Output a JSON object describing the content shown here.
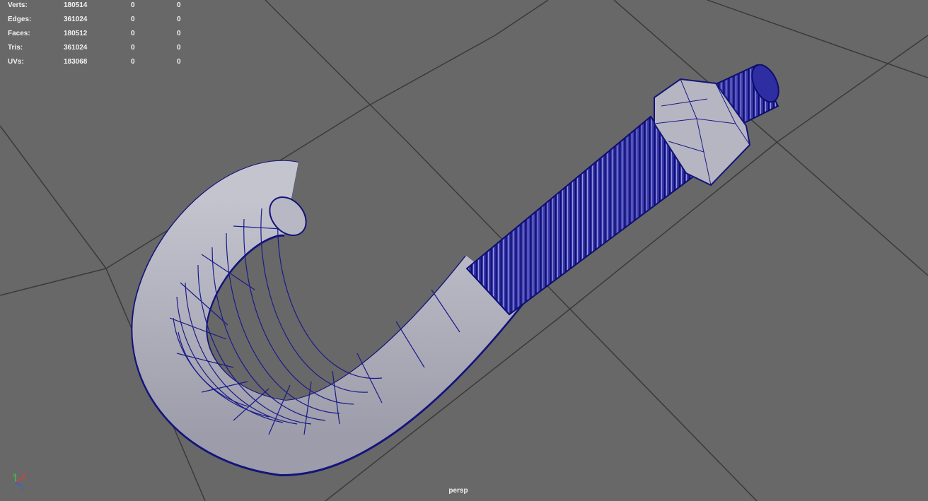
{
  "stats": [
    {
      "label": "Verts:",
      "total": "180514",
      "selected": "0",
      "component": "0"
    },
    {
      "label": "Edges:",
      "total": "361024",
      "selected": "0",
      "component": "0"
    },
    {
      "label": "Faces:",
      "total": "180512",
      "selected": "0",
      "component": "0"
    },
    {
      "label": "Tris:",
      "total": "361024",
      "selected": "0",
      "component": "0"
    },
    {
      "label": "UVs:",
      "total": "183068",
      "selected": "0",
      "component": "0"
    }
  ],
  "camera": {
    "name": "persp"
  },
  "axis_gizmo": {
    "x": "x",
    "y": "y",
    "z": "z"
  },
  "colors": {
    "background": "#686868",
    "grid": "#3a3a3a",
    "surface": "#aeaeb9",
    "wireframe": "#16168a",
    "hud_text": "#f2f2f2",
    "axis_x": "#e03a3a",
    "axis_y": "#42c042",
    "axis_z": "#3a5ae0"
  },
  "icons": [
    "axis-gizmo-icon"
  ]
}
